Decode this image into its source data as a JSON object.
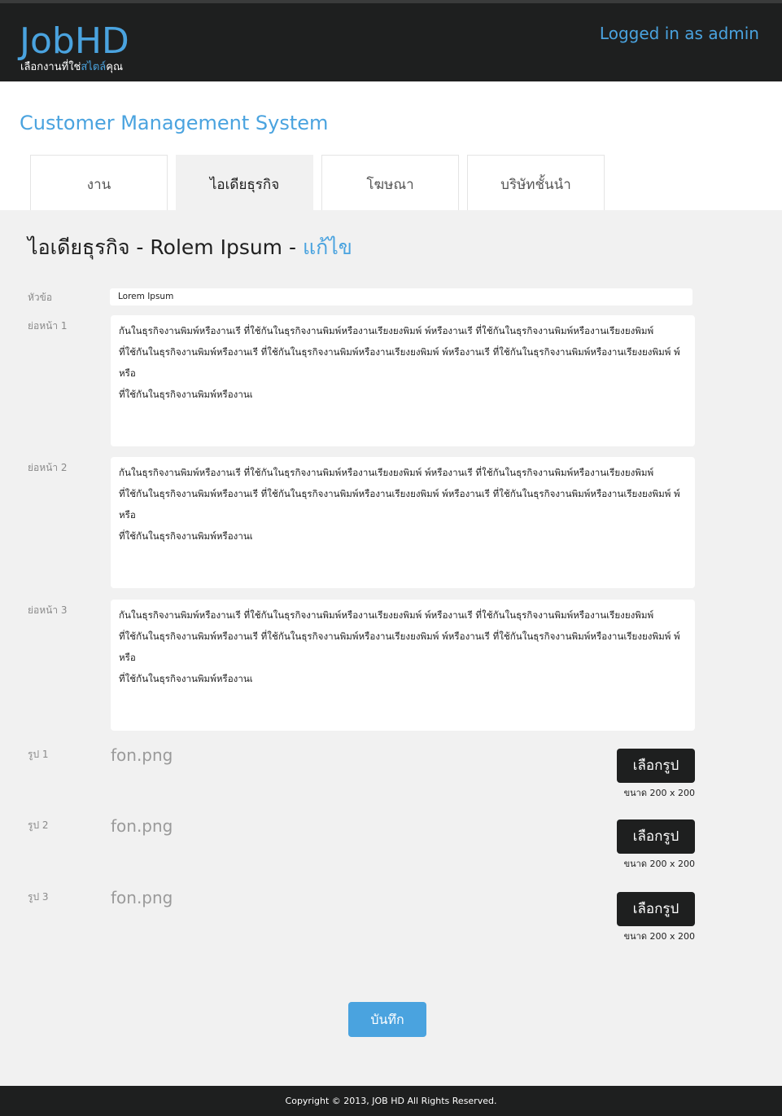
{
  "header": {
    "logo_title": "JobHD",
    "logo_tagline_pre": "เลือกงานที่ใช่",
    "logo_tagline_highlight": "สไตล์",
    "logo_tagline_post": "คุณ",
    "login_text": "Logged in as admin"
  },
  "system_title": "Customer Management System",
  "tabs": [
    {
      "label": "งาน",
      "active": false
    },
    {
      "label": "ไอเดียธุรกิจ",
      "active": true
    },
    {
      "label": "โฆษณา",
      "active": false
    },
    {
      "label": "บริษัทชั้นนำ",
      "active": false
    }
  ],
  "heading": {
    "text": "ไอเดียธุรกิจ - Rolem Ipsum - ",
    "edit_label": "แก้ไข"
  },
  "form": {
    "title_label": "หัวข้อ",
    "title_value": "Lorem Ipsum",
    "paragraphs": [
      {
        "label": "ย่อหน้า 1",
        "lines": [
          "กันในธุรกิจงานพิมพ์หรืองานเรี ที่ใช้กันในธุรกิจงานพิมพ์หรืองานเรียงยงพิมพ์ พ์หรืองานเรี ที่ใช้กันในธุรกิจงานพิมพ์หรืองานเรียงยงพิมพ์",
          "ที่ใช้กันในธุรกิจงานพิมพ์หรืองานเรี ที่ใช้กันในธุรกิจงานพิมพ์หรืองานเรียงยงพิมพ์ พ์หรืองานเรี ที่ใช้กันในธุรกิจงานพิมพ์หรืองานเรียงยงพิมพ์ พ์หรือ",
          "ที่ใช้กันในธุรกิจงานพิมพ์หรืองานเ"
        ]
      },
      {
        "label": "ย่อหน้า 2",
        "lines": [
          "กันในธุรกิจงานพิมพ์หรืองานเรี ที่ใช้กันในธุรกิจงานพิมพ์หรืองานเรียงยงพิมพ์ พ์หรืองานเรี ที่ใช้กันในธุรกิจงานพิมพ์หรืองานเรียงยงพิมพ์",
          "ที่ใช้กันในธุรกิจงานพิมพ์หรืองานเรี ที่ใช้กันในธุรกิจงานพิมพ์หรืองานเรียงยงพิมพ์ พ์หรืองานเรี ที่ใช้กันในธุรกิจงานพิมพ์หรืองานเรียงยงพิมพ์ พ์หรือ",
          "ที่ใช้กันในธุรกิจงานพิมพ์หรืองานเ"
        ]
      },
      {
        "label": "ย่อหน้า 3",
        "lines": [
          "กันในธุรกิจงานพิมพ์หรืองานเรี ที่ใช้กันในธุรกิจงานพิมพ์หรืองานเรียงยงพิมพ์ พ์หรืองานเรี ที่ใช้กันในธุรกิจงานพิมพ์หรืองานเรียงยงพิมพ์",
          "ที่ใช้กันในธุรกิจงานพิมพ์หรืองานเรี ที่ใช้กันในธุรกิจงานพิมพ์หรืองานเรียงยงพิมพ์ พ์หรืองานเรี ที่ใช้กันในธุรกิจงานพิมพ์หรืองานเรียงยงพิมพ์ พ์หรือ",
          "ที่ใช้กันในธุรกิจงานพิมพ์หรืองานเ"
        ]
      }
    ],
    "images": [
      {
        "label": "รูป 1",
        "filename": "fon.png",
        "button_label": "เลือกรูป",
        "size_note": "ขนาด 200 x 200"
      },
      {
        "label": "รูป 2",
        "filename": "fon.png",
        "button_label": "เลือกรูป",
        "size_note": "ขนาด 200 x 200"
      },
      {
        "label": "รูป 3",
        "filename": "fon.png",
        "button_label": "เลือกรูป",
        "size_note": "ขนาด 200 x 200"
      }
    ],
    "save_label": "บันทึก"
  },
  "footer": {
    "copyright": "Copyright © 2013, JOB HD All Rights Reserved."
  },
  "colors": {
    "accent": "#4aa3df",
    "dark": "#1e1f1f",
    "panel": "#f1f1f1"
  }
}
